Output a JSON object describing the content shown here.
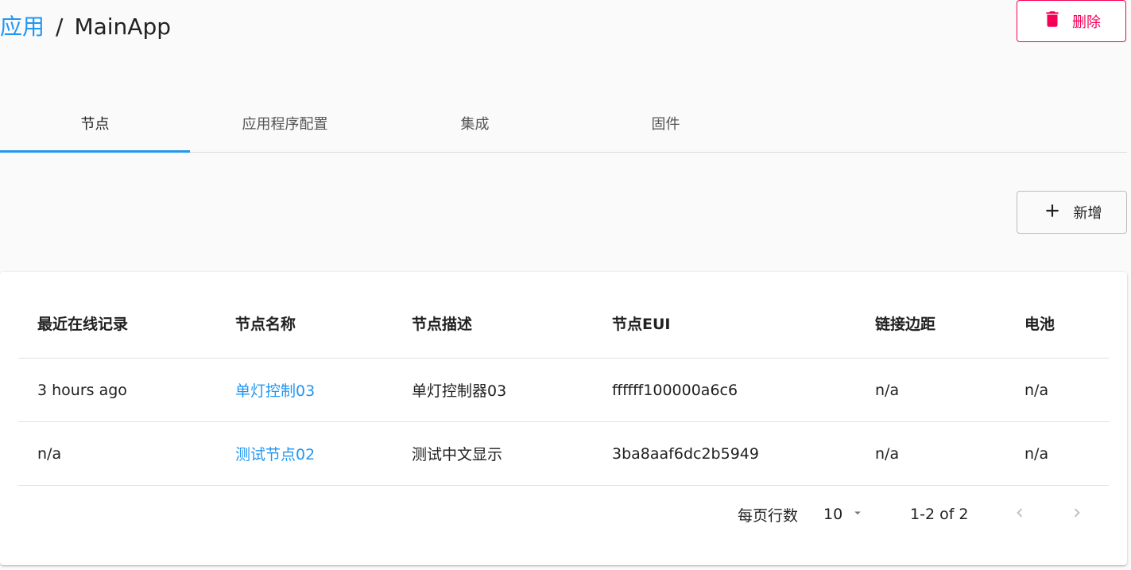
{
  "breadcrumb": {
    "parent": "应用",
    "separator": "/",
    "current": "MainApp"
  },
  "header": {
    "delete_label": "删除",
    "delete_color": "#f50057"
  },
  "tabs": [
    {
      "label": "节点",
      "active": true
    },
    {
      "label": "应用程序配置",
      "active": false
    },
    {
      "label": "集成",
      "active": false
    },
    {
      "label": "固件",
      "active": false
    }
  ],
  "toolbar": {
    "add_label": "新增"
  },
  "table": {
    "columns": [
      "最近在线记录",
      "节点名称",
      "节点描述",
      "节点EUI",
      "链接边距",
      "电池"
    ],
    "rows": [
      {
        "last_seen": "3 hours ago",
        "name": "单灯控制03",
        "description": "单灯控制器03",
        "eui": "ffffff100000a6c6",
        "link_margin": "n/a",
        "battery": "n/a"
      },
      {
        "last_seen": "n/a",
        "name": "测试节点02",
        "description": "测试中文显示",
        "eui": "3ba8aaf6dc2b5949",
        "link_margin": "n/a",
        "battery": "n/a"
      }
    ]
  },
  "pagination": {
    "rows_per_page_label": "每页行数",
    "rows_per_page": "10",
    "range": "1-2 of 2"
  },
  "colors": {
    "accent": "#2196f3",
    "danger": "#f50057"
  }
}
